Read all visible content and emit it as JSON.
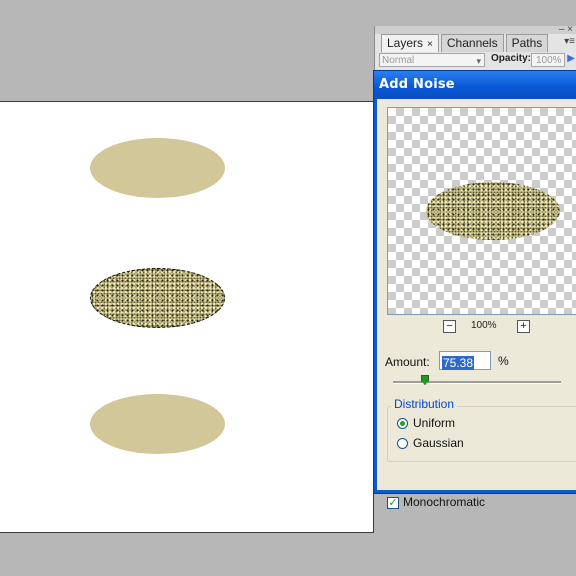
{
  "layers_palette": {
    "tabs": [
      {
        "label": "Layers",
        "close": "×"
      },
      {
        "label": "Channels"
      },
      {
        "label": "Paths"
      }
    ],
    "blend_mode": "Normal",
    "opacity_label": "Opacity:",
    "opacity_value": "100%"
  },
  "dialog": {
    "title": "Add Noise",
    "zoom_out": "−",
    "zoom_value": "100%",
    "zoom_in": "+",
    "amount_label": "Amount:",
    "amount_value": "75.38",
    "amount_unit": "%",
    "distribution_label": "Distribution",
    "distribution_options": [
      "Uniform",
      "Gaussian"
    ],
    "distribution_selected": "Uniform",
    "monochromatic_label": "Monochromatic",
    "monochromatic_checked": true
  },
  "colors": {
    "ellipse_fill": "#d1c798",
    "titlebar": "#0a5bd0",
    "dialog_bg": "#ece9d8"
  }
}
